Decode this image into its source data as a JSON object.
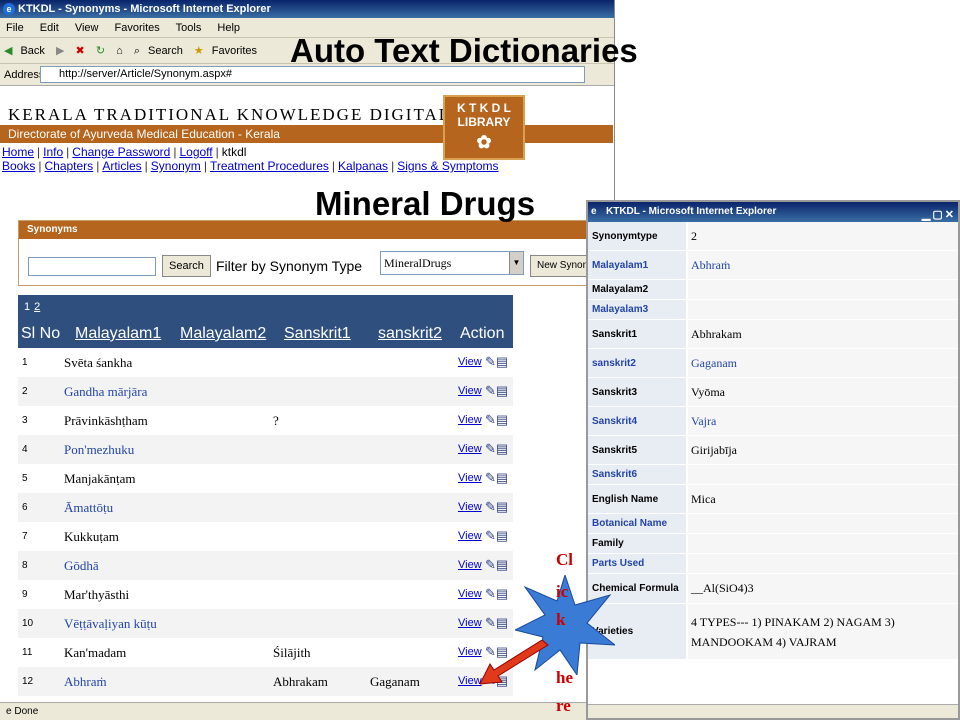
{
  "browser": {
    "title": "KTKDL - Synonyms - Microsoft Internet Explorer",
    "menu": [
      "File",
      "Edit",
      "View",
      "Favorites",
      "Tools",
      "Help"
    ],
    "toolbar": [
      "Back",
      "Search",
      "Favorites"
    ],
    "address_label": "Address",
    "url": "http://server/Article/Synonym.aspx#"
  },
  "overlay": {
    "heading1": "Auto Text Dictionaries",
    "heading2": "Mineral Drugs",
    "callout": [
      "Cl",
      "ic",
      "k",
      "he",
      "re"
    ]
  },
  "banner": {
    "title": "KERALA TRADITIONAL KNOWLEDGE DIGITAL",
    "subtitle": "Directorate of Ayurveda Medical Education - Kerala",
    "logo_line1": "K T K D L",
    "logo_line2": "LIBRARY"
  },
  "nav1": [
    "Home",
    "Info",
    "Change Password",
    "Logoff",
    "ktkdl"
  ],
  "nav2": [
    "Books",
    "Chapters",
    "Articles",
    "Synonym",
    "Treatment Procedures",
    "Kalpanas",
    "Signs & Symptoms"
  ],
  "synonyms_panel": {
    "header": "Synonyms",
    "search_button": "Search",
    "filter_label": "Filter by Synonym Type",
    "filter_value": "MineralDrugs",
    "new_button": "New Synonym"
  },
  "grid": {
    "pager": [
      "1",
      "2"
    ],
    "columns": [
      "Sl No",
      "Malayalam1",
      "Malayalam2",
      "Sanskrit1",
      "sanskrit2",
      "Action"
    ],
    "rows": [
      {
        "sl": "1",
        "m1": "Svēta śankha",
        "m2": "",
        "s1": "",
        "s2": "",
        "action": "View"
      },
      {
        "sl": "2",
        "m1": "Gandha mārjāra",
        "m2": "",
        "s1": "",
        "s2": "",
        "action": "View"
      },
      {
        "sl": "3",
        "m1": "Prāvinkāshṭham",
        "m2": "",
        "s1": "?",
        "s2": "",
        "action": "View"
      },
      {
        "sl": "4",
        "m1": "Pon'mezhuku",
        "m2": "",
        "s1": "",
        "s2": "",
        "action": "View"
      },
      {
        "sl": "5",
        "m1": "Manjakānṭam",
        "m2": "",
        "s1": "",
        "s2": "",
        "action": "View"
      },
      {
        "sl": "6",
        "m1": "Āmattōṭu",
        "m2": "",
        "s1": "",
        "s2": "",
        "action": "View"
      },
      {
        "sl": "7",
        "m1": "Kukkuṭam",
        "m2": "",
        "s1": "",
        "s2": "",
        "action": "View"
      },
      {
        "sl": "8",
        "m1": "Gōdhā",
        "m2": "",
        "s1": "",
        "s2": "",
        "action": "View"
      },
      {
        "sl": "9",
        "m1": "Mar'thyāsthi",
        "m2": "",
        "s1": "",
        "s2": "",
        "action": "View"
      },
      {
        "sl": "10",
        "m1": "Vēṭṭāvaḷiyan kūṭu",
        "m2": "",
        "s1": "",
        "s2": "",
        "action": "View"
      },
      {
        "sl": "11",
        "m1": "Kan'madam",
        "m2": "",
        "s1": "Śilājith",
        "s2": "",
        "action": "View"
      },
      {
        "sl": "12",
        "m1": "Abhraṁ",
        "m2": "",
        "s1": "Abhrakam",
        "s2": "Gaganam",
        "action": "View"
      }
    ]
  },
  "status": "Done",
  "popup": {
    "title": "KTKDL - Microsoft Internet Explorer",
    "fields": [
      {
        "key": "Synonymtype",
        "value": "2"
      },
      {
        "key": "Malayalam1",
        "value": "Abhraṁ"
      },
      {
        "key": "Malayalam2",
        "value": ""
      },
      {
        "key": "Malayalam3",
        "value": ""
      },
      {
        "key": "Sanskrit1",
        "value": "Abhrakam"
      },
      {
        "key": "sanskrit2",
        "value": "Gaganam"
      },
      {
        "key": "Sanskrit3",
        "value": "Vyōma"
      },
      {
        "key": "Sanskrit4",
        "value": "Vajra"
      },
      {
        "key": "Sanskrit5",
        "value": "Girijabīja"
      },
      {
        "key": "Sanskrit6",
        "value": ""
      },
      {
        "key": "English Name",
        "value": "Mica"
      },
      {
        "key": "Botanical Name",
        "value": ""
      },
      {
        "key": "Family",
        "value": ""
      },
      {
        "key": "Parts Used",
        "value": ""
      },
      {
        "key": "Chemical Formula",
        "value": "__Al(SiO4)3"
      },
      {
        "key": "Varieties",
        "value": "4 TYPES--- 1) PINAKAM 2) NAGAM 3) MANDOOKAM 4) VAJRAM"
      }
    ]
  }
}
